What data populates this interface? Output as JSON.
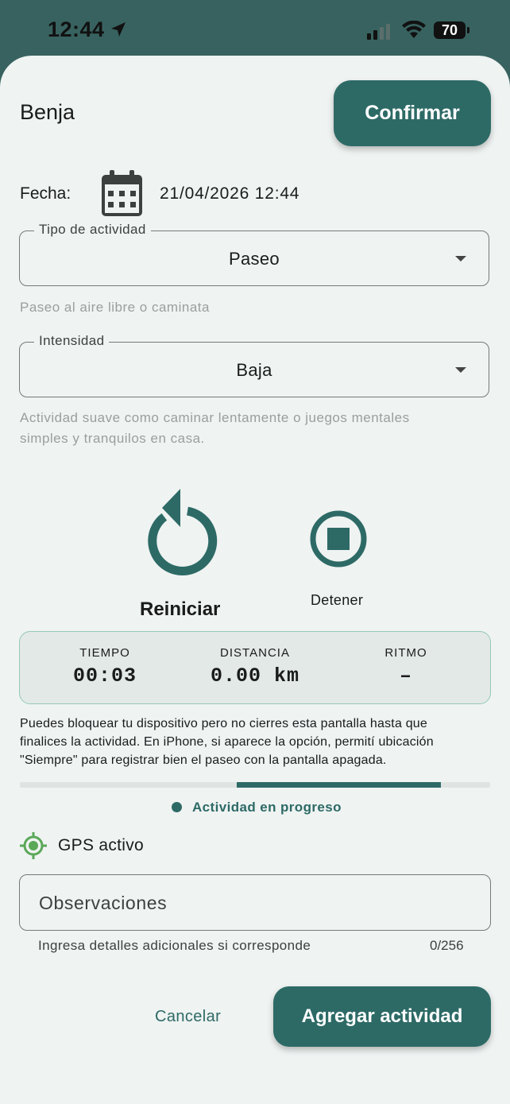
{
  "status_bar": {
    "time": "12:44",
    "battery": "70"
  },
  "header": {
    "user_name": "Benja",
    "confirm_label": "Confirmar"
  },
  "fecha": {
    "label": "Fecha:",
    "value": "21/04/2026 12:44",
    "icon": "calendar-icon"
  },
  "tipo_actividad": {
    "label": "Tipo de actividad",
    "value": "Paseo",
    "helper": "Paseo al aire libre o caminata"
  },
  "intensidad": {
    "label": "Intensidad",
    "value": "Baja",
    "helper_line1": "Actividad suave como caminar lentamente o juegos mentales",
    "helper_line2": "simples y tranquilos en casa."
  },
  "controls": {
    "restart_label": "Reiniciar",
    "stop_label": "Detener"
  },
  "stats": {
    "tiempo": {
      "label": "TIEMPO",
      "value": "00:03"
    },
    "distancia": {
      "label": "DISTANCIA",
      "value": "0.00 km"
    },
    "ritmo": {
      "label": "RITMO",
      "value": "–"
    }
  },
  "notice": {
    "line1": "Puedes bloquear tu dispositivo pero no cierres esta pantalla hasta que",
    "line2": "finalices la actividad. En iPhone, si aparece la opción, permití ubicación",
    "line3": "\"Siempre\" para registrar bien el paseo con la pantalla apagada."
  },
  "progress": {
    "label": "Actividad en progreso"
  },
  "gps": {
    "label": "GPS activo"
  },
  "observaciones": {
    "placeholder": "Observaciones",
    "helper": "Ingresa detalles adicionales si corresponde",
    "counter": "0/256"
  },
  "footer": {
    "cancel_label": "Cancelar",
    "add_label": "Agregar actividad"
  },
  "colors": {
    "primary": "#2d6a66",
    "header_bg": "#38625f",
    "background": "#eff3f2",
    "gps_green": "#5aa858"
  }
}
